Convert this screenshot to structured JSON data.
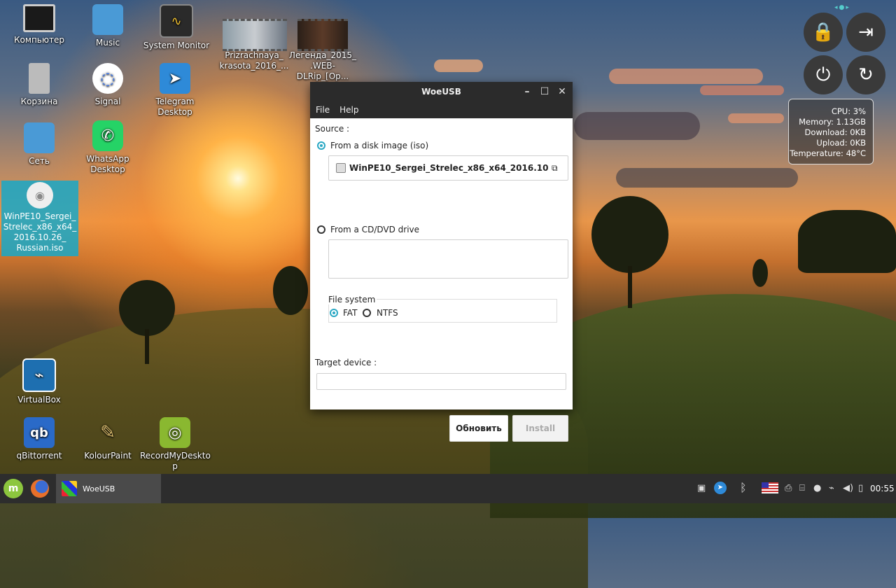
{
  "desktop": {
    "icons": [
      {
        "label": "Компьютер"
      },
      {
        "label": "Music"
      },
      {
        "label": "System Monitor"
      },
      {
        "label": "Prizrachnaya_\nkrasota_2016_..."
      },
      {
        "label": "Легенда_2015_\n.WEB-DLRip_[Op..."
      },
      {
        "label": "Корзина"
      },
      {
        "label": "Signal"
      },
      {
        "label": "Telegram Desktop"
      },
      {
        "label": "Сеть"
      },
      {
        "label": "WhatsApp\nDesktop"
      },
      {
        "label": "WinPE10_Sergei_\nStrelec_x86_x64_\n2016.10.26_\nRussian.iso"
      },
      {
        "label": "VirtualBox"
      },
      {
        "label": "qBittorrent"
      },
      {
        "label": "KolourPaint"
      },
      {
        "label": "RecordMyDeskto\np"
      }
    ]
  },
  "sysmon": {
    "cpu": "CPU: 3%",
    "memory": "Memory: 1.13GB",
    "download": "Download: 0KB",
    "upload": "Upload: 0KB",
    "temperature": "Temperature: 48°C"
  },
  "window": {
    "title": "WoeUSB",
    "menu": {
      "file": "File",
      "help": "Help"
    },
    "source_label": "Source :",
    "from_image_label": "From a disk image (iso)",
    "image_file": "WinPE10_Sergei_Strelec_x86_x64_2016.10....",
    "from_cd_label": "From a CD/DVD drive",
    "filesystem_label": "File system",
    "fat_label": "FAT",
    "ntfs_label": "NTFS",
    "target_label": "Target device :",
    "refresh_button": "Обновить",
    "install_button": "Install"
  },
  "taskbar": {
    "task_label": "WoeUSB",
    "clock": "00:55"
  },
  "colors": {
    "accent": "#2aa8c4",
    "titlebar": "#2b2b2b",
    "taskbar": "#2d2d2d"
  }
}
